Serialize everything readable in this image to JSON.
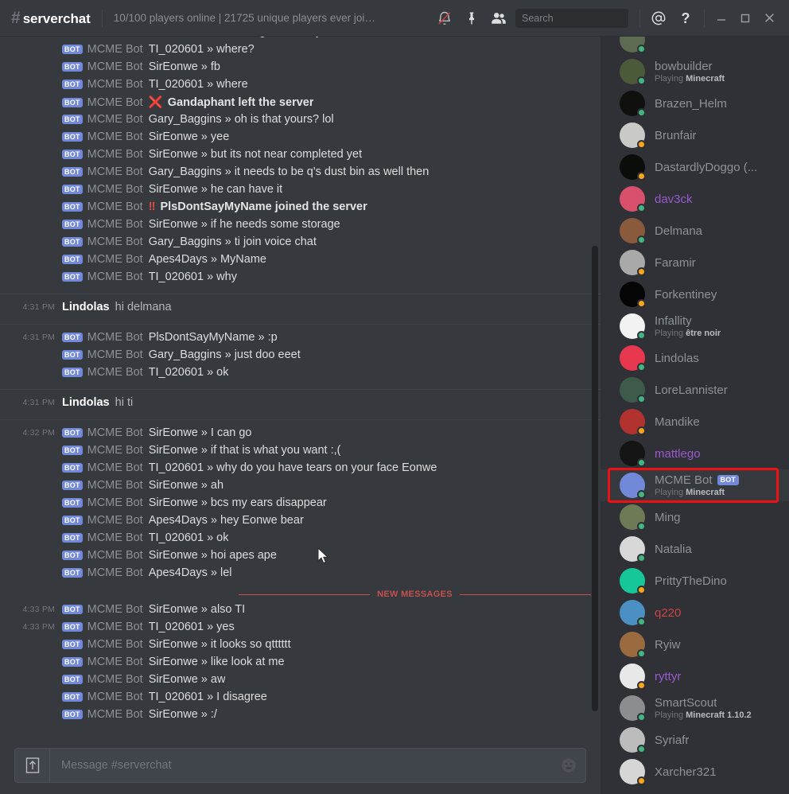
{
  "window": {
    "minimize_label": "Minimize",
    "maximize_label": "Maximize",
    "close_label": "Close"
  },
  "header": {
    "hash": "#",
    "channel": "serverchat",
    "topic": "10/100 players online | 21725 unique players ever join...",
    "icons": [
      "notifications-off-icon",
      "pinned-messages-icon",
      "member-list-icon"
    ],
    "mention_label": "@",
    "help_label": "?"
  },
  "search": {
    "placeholder": "Search",
    "value": ""
  },
  "composer": {
    "placeholder": "Message #serverchat",
    "value": "",
    "upload_label": "Upload a file",
    "emoji_label": "Emoji"
  },
  "new_messages_divider": {
    "label": "NEW MESSAGES",
    "color": "#c5514f"
  },
  "colors": {
    "accent": "#7289da",
    "online": "#43b581",
    "idle": "#faa61a",
    "highlight_box": "#ee1111",
    "chat_bg": "#36393e",
    "members_bg": "#2f3136"
  },
  "chat": {
    "groups": [
      {
        "timestamp": "",
        "divided": false,
        "clipped": true,
        "messages": [
          {
            "bot": true,
            "author": "MCME Bot",
            "text": "SirEonwe » im building his money bin lol"
          },
          {
            "bot": true,
            "author": "MCME Bot",
            "text": "TI_020601 » where?"
          },
          {
            "bot": true,
            "author": "MCME Bot",
            "text": "SirEonwe » fb"
          },
          {
            "bot": true,
            "author": "MCME Bot",
            "text": "TI_020601 » where"
          },
          {
            "bot": true,
            "author": "MCME Bot",
            "system": "leave",
            "mark": "❌",
            "text": "Gandaphant left the server"
          },
          {
            "bot": true,
            "author": "MCME Bot",
            "text": "Gary_Baggins » oh is that yours? lol"
          },
          {
            "bot": true,
            "author": "MCME Bot",
            "text": "SirEonwe » yee"
          },
          {
            "bot": true,
            "author": "MCME Bot",
            "text": "SirEonwe » but its not near completed yet"
          },
          {
            "bot": true,
            "author": "MCME Bot",
            "text": "Gary_Baggins » it needs to be q's dust bin as well then"
          },
          {
            "bot": true,
            "author": "MCME Bot",
            "text": "SirEonwe » he can have it"
          },
          {
            "bot": true,
            "author": "MCME Bot",
            "system": "join",
            "mark": "‼",
            "text": "PlsDontSayMyName joined the server"
          },
          {
            "bot": true,
            "author": "MCME Bot",
            "text": "SirEonwe » if he needs some storage"
          },
          {
            "bot": true,
            "author": "MCME Bot",
            "text": "Gary_Baggins » ti join voice chat"
          },
          {
            "bot": true,
            "author": "MCME Bot",
            "text": "Apes4Days » MyName"
          },
          {
            "bot": true,
            "author": "MCME Bot",
            "text": "TI_020601 » why"
          }
        ]
      },
      {
        "divided": true,
        "messages": [
          {
            "timestamp": "4:31 PM",
            "bot": false,
            "author": "Lindolas",
            "text": "hi delmana"
          }
        ]
      },
      {
        "divided": true,
        "messages": [
          {
            "timestamp": "4:31 PM",
            "bot": true,
            "author": "MCME Bot",
            "text": "PlsDontSayMyName » :p"
          },
          {
            "bot": true,
            "author": "MCME Bot",
            "text": "Gary_Baggins » just doo eeet"
          },
          {
            "bot": true,
            "author": "MCME Bot",
            "text": "TI_020601 » ok"
          }
        ]
      },
      {
        "divided": true,
        "messages": [
          {
            "timestamp": "4:31 PM",
            "bot": false,
            "author": "Lindolas",
            "text": "hi ti"
          }
        ]
      },
      {
        "divided": true,
        "messages": [
          {
            "timestamp": "4:32 PM",
            "bot": true,
            "author": "MCME Bot",
            "text": "SirEonwe » I can go"
          },
          {
            "bot": true,
            "author": "MCME Bot",
            "text": "SirEonwe » if that is what you want :,("
          },
          {
            "bot": true,
            "author": "MCME Bot",
            "text": "TI_020601 » why do you have tears on your face Eonwe"
          },
          {
            "bot": true,
            "author": "MCME Bot",
            "text": "SirEonwe » ah"
          },
          {
            "bot": true,
            "author": "MCME Bot",
            "text": "SirEonwe » bcs my ears disappear"
          },
          {
            "bot": true,
            "author": "MCME Bot",
            "text": "Apes4Days » hey Eonwe bear"
          },
          {
            "bot": true,
            "author": "MCME Bot",
            "text": "TI_020601 » ok"
          },
          {
            "bot": true,
            "author": "MCME Bot",
            "text": "SirEonwe » hoi apes ape"
          },
          {
            "bot": true,
            "author": "MCME Bot",
            "text": "Apes4Days » lel"
          }
        ]
      },
      {
        "divider_new_messages": true,
        "messages": [
          {
            "timestamp": "4:33 PM",
            "bot": true,
            "author": "MCME Bot",
            "text": "SirEonwe » also TI"
          },
          {
            "timestamp": "4:33 PM",
            "bot": true,
            "author": "MCME Bot",
            "text": "TI_020601 » yes"
          },
          {
            "bot": true,
            "author": "MCME Bot",
            "text": "SirEonwe » it looks so qtttttt"
          },
          {
            "bot": true,
            "author": "MCME Bot",
            "text": "SirEonwe » like look at me"
          },
          {
            "bot": true,
            "author": "MCME Bot",
            "text": "SirEonwe » aw"
          },
          {
            "bot": true,
            "author": "MCME Bot",
            "text": "TI_020601 » I disagree"
          },
          {
            "bot": true,
            "author": "MCME Bot",
            "text": "SirEonwe » :/"
          }
        ]
      }
    ]
  },
  "members": {
    "list": [
      {
        "name": "",
        "status": "online",
        "game": "",
        "clipped": true,
        "avatar_bg": "#5d6b52",
        "initials": ""
      },
      {
        "name": "bowbuilder",
        "status": "online",
        "game": "Playing ",
        "game_bold": "Minecraft",
        "avatar_bg": "#4b5a39",
        "initials": ""
      },
      {
        "name": "Brazen_Helm",
        "status": "online",
        "game": "",
        "avatar_bg": "#10100f",
        "initials": ""
      },
      {
        "name": "Brunfair",
        "status": "idle",
        "game": "",
        "avatar_bg": "#c9c9c5",
        "initials": ""
      },
      {
        "name": "DastardlyDoggo (...",
        "status": "idle",
        "game": "",
        "avatar_bg": "#0b0d0a",
        "initials": ""
      },
      {
        "name": "dav3ck",
        "status": "online",
        "game": "",
        "color": "#9b59d0",
        "avatar_bg": "#d9506c",
        "initials": ""
      },
      {
        "name": "Delmana",
        "status": "online",
        "game": "",
        "avatar_bg": "#8a5a3c",
        "initials": ""
      },
      {
        "name": "Faramir",
        "status": "idle",
        "game": "",
        "avatar_bg": "#a9a9a9",
        "initials": ""
      },
      {
        "name": "Forkentiney",
        "status": "idle",
        "game": "",
        "avatar_bg": "#050505",
        "initials": ""
      },
      {
        "name": "Infallity",
        "status": "online",
        "game": "Playing ",
        "game_bold": "être noir",
        "avatar_bg": "#f2f2f2",
        "initials": ""
      },
      {
        "name": "Lindolas",
        "status": "online",
        "game": "",
        "avatar_bg": "#e8384f",
        "initials": ""
      },
      {
        "name": "LoreLannister",
        "status": "online",
        "game": "",
        "avatar_bg": "#3d5a4a",
        "initials": ""
      },
      {
        "name": "Mandike",
        "status": "idle",
        "game": "",
        "avatar_bg": "#b1322f",
        "initials": ""
      },
      {
        "name": "mattlego",
        "status": "online",
        "game": "",
        "color": "#9b59d0",
        "avatar_bg": "#141414",
        "initials": ""
      },
      {
        "name": "MCME Bot",
        "status": "online",
        "game": "Playing ",
        "game_bold": "Minecraft",
        "bot": true,
        "highlight": true,
        "avatar_bg": "#7289da",
        "initials": ""
      },
      {
        "name": "Ming",
        "status": "online",
        "game": "",
        "avatar_bg": "#6e7a55",
        "initials": ""
      },
      {
        "name": "Natalia",
        "status": "online",
        "game": "",
        "avatar_bg": "#d8d8d8",
        "initials": ""
      },
      {
        "name": "PrittyTheDino",
        "status": "idle",
        "game": "",
        "avatar_bg": "#16c79a",
        "initials": ""
      },
      {
        "name": "q220",
        "status": "online",
        "game": "",
        "color": "#d0453e",
        "avatar_bg": "#4a90c2",
        "initials": ""
      },
      {
        "name": "Ryiw",
        "status": "online",
        "game": "",
        "avatar_bg": "#9a6b3f",
        "initials": ""
      },
      {
        "name": "ryttyr",
        "status": "idle",
        "game": "",
        "color": "#9b59d0",
        "avatar_bg": "#e8e8e8",
        "initials": ""
      },
      {
        "name": "SmartScout",
        "status": "online",
        "game": "Playing ",
        "game_bold": "Minecraft 1.10.2",
        "avatar_bg": "#8b8d90",
        "initials": ""
      },
      {
        "name": "Syriafr",
        "status": "online",
        "game": "",
        "avatar_bg": "#bcbcbc",
        "initials": ""
      },
      {
        "name": "Xarcher321",
        "status": "idle",
        "game": "",
        "avatar_bg": "#d6d6d6",
        "initials": ""
      }
    ]
  }
}
